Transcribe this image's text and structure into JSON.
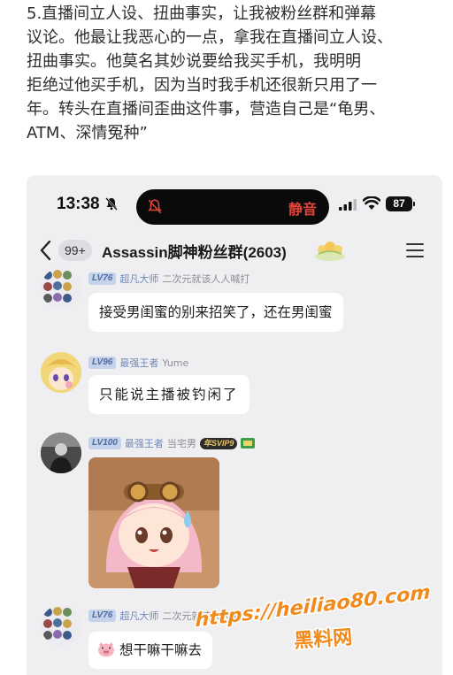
{
  "article": {
    "lines": [
      "5.直播间立人设、扭曲事实，让我被粉丝群和弹幕",
      "议论。他最让我恶心的一点，拿我在直播间立人设、",
      "扭曲事实。他莫名其妙说要给我买手机，我明明",
      "拒绝过他买手机，因为当时我手机还很新只用了一",
      "年。转头在直播间歪曲这件事，营造自己是“龟男、",
      "ATM、深情冤种”"
    ]
  },
  "status_bar": {
    "time": "13:38",
    "island_label": "静音",
    "battery": "87"
  },
  "chat_header": {
    "unread": "99+",
    "title": "Assassin脚神粉丝群(2603)"
  },
  "messages": [
    {
      "level": "LV76",
      "title": "超凡大师",
      "nick": "二次元就该人人喊打",
      "text": "接受男闺蜜的别来招笑了，还在男闺蜜"
    },
    {
      "level": "LV96",
      "title": "最强王者",
      "nick": "Yume",
      "text": "只能说主播被钓闲了"
    },
    {
      "level": "LV100",
      "title": "最强王者",
      "nick": "当宅男",
      "badge": "年SVIP9",
      "text": ""
    },
    {
      "level": "LV76",
      "title": "超凡大师",
      "nick": "二次元就该人人喊打",
      "text": "想干嘛干嘛去"
    }
  ],
  "colors": {
    "phone_bg": "#efeff2",
    "level_tag": "#c4d2ea",
    "mute_text": "#e0443a",
    "watermark": "#f08a1c"
  }
}
